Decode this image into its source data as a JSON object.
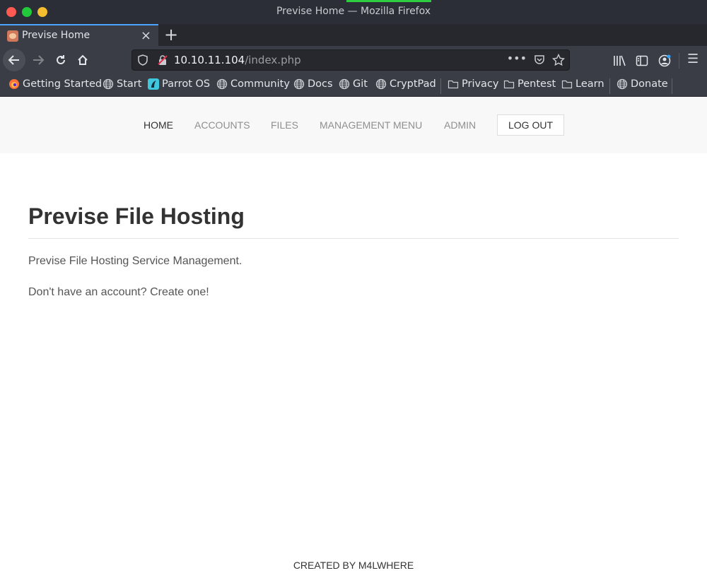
{
  "window": {
    "title": "Previse Home — Mozilla Firefox"
  },
  "tab": {
    "title": "Previse Home",
    "close_icon": "×",
    "new_tab_icon": "+"
  },
  "navbar": {
    "url_host": "10.10.11.104",
    "url_path": "/index.php",
    "more_icon": "•••",
    "menu_icon": "☰"
  },
  "bookmarks": [
    {
      "label": "Getting Started",
      "icon": "firefox-icon"
    },
    {
      "label": "Start",
      "icon": "globe-icon"
    },
    {
      "label": "Parrot OS",
      "icon": "parrot-icon"
    },
    {
      "label": "Community",
      "icon": "globe-icon"
    },
    {
      "label": "Docs",
      "icon": "globe-icon"
    },
    {
      "label": "Git",
      "icon": "globe-icon"
    },
    {
      "label": "CryptPad",
      "icon": "globe-icon"
    },
    {
      "label": "Privacy",
      "icon": "folder-icon"
    },
    {
      "label": "Pentest",
      "icon": "folder-icon"
    },
    {
      "label": "Learn",
      "icon": "folder-icon"
    },
    {
      "label": "Donate",
      "icon": "globe-icon"
    }
  ],
  "site": {
    "menu": [
      "HOME",
      "ACCOUNTS",
      "FILES",
      "MANAGEMENT MENU",
      "ADMIN"
    ],
    "logout_label": "LOG OUT",
    "heading": "Previse File Hosting",
    "description": "Previse File Hosting Service Management.",
    "signup_prompt": "Don't have an account? Create one!",
    "footer": "CREATED BY M4LWHERE"
  },
  "colors": {
    "accent": "#4aa3ff",
    "chrome_dark": "#2b2e36",
    "toolbar": "#3a3d45"
  }
}
